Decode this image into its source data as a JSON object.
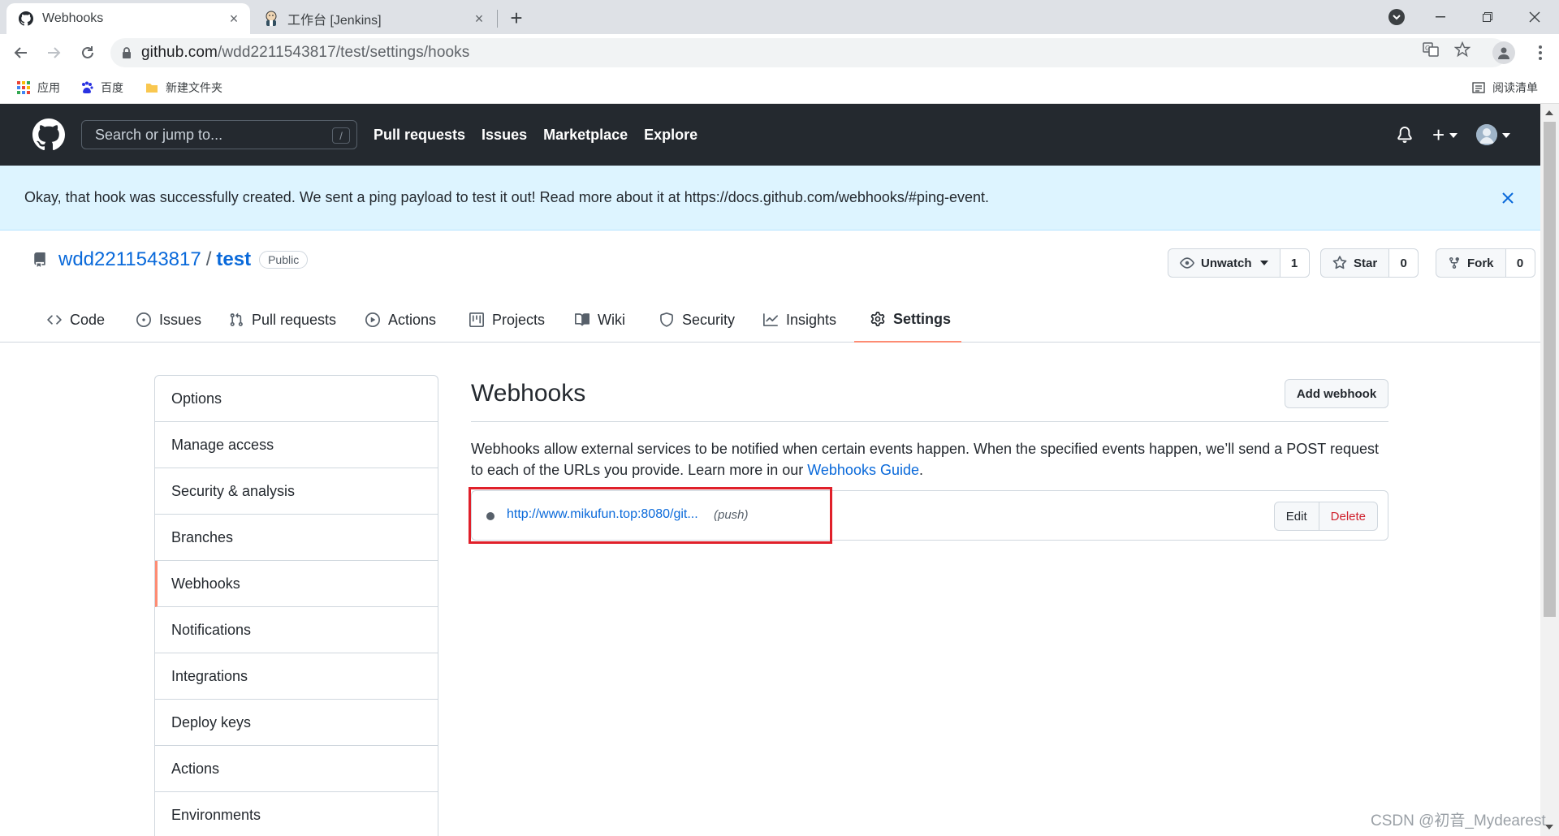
{
  "browser": {
    "tabs": [
      {
        "title": "Webhooks",
        "icon": "github-icon",
        "active": true
      },
      {
        "title": "工作台 [Jenkins]",
        "icon": "jenkins-icon",
        "active": false
      }
    ],
    "url_host": "github.com",
    "url_path": "/wdd2211543817/test/settings/hooks",
    "bookmarks": [
      {
        "label": "应用",
        "icon": "apps-grid-icon"
      },
      {
        "label": "百度",
        "icon": "baidu-paw-icon"
      },
      {
        "label": "新建文件夹",
        "icon": "folder-icon"
      }
    ],
    "reading_list": "阅读清单"
  },
  "header": {
    "search_placeholder": "Search or jump to...",
    "search_shortcut": "/",
    "nav": [
      "Pull requests",
      "Issues",
      "Marketplace",
      "Explore"
    ]
  },
  "flash": {
    "message": "Okay, that hook was successfully created. We sent a ping payload to test it out! Read more about it at https://docs.github.com/webhooks/#ping-event."
  },
  "repo": {
    "owner": "wdd2211543817",
    "separator": "/",
    "name": "test",
    "visibility": "Public",
    "watch_label": "Unwatch",
    "watch_count": "1",
    "star_label": "Star",
    "star_count": "0",
    "fork_label": "Fork",
    "fork_count": "0"
  },
  "repo_nav": [
    {
      "label": "Code",
      "icon": "code-icon"
    },
    {
      "label": "Issues",
      "icon": "issue-opened-icon"
    },
    {
      "label": "Pull requests",
      "icon": "git-pull-request-icon"
    },
    {
      "label": "Actions",
      "icon": "play-icon"
    },
    {
      "label": "Projects",
      "icon": "project-icon"
    },
    {
      "label": "Wiki",
      "icon": "book-icon"
    },
    {
      "label": "Security",
      "icon": "shield-icon"
    },
    {
      "label": "Insights",
      "icon": "graph-icon"
    },
    {
      "label": "Settings",
      "icon": "gear-icon",
      "selected": true
    }
  ],
  "sidebar": {
    "items": [
      {
        "label": "Options"
      },
      {
        "label": "Manage access"
      },
      {
        "label": "Security & analysis"
      },
      {
        "label": "Branches"
      },
      {
        "label": "Webhooks",
        "selected": true
      },
      {
        "label": "Notifications"
      },
      {
        "label": "Integrations"
      },
      {
        "label": "Deploy keys"
      },
      {
        "label": "Actions"
      },
      {
        "label": "Environments"
      }
    ]
  },
  "main": {
    "title": "Webhooks",
    "add_button": "Add webhook",
    "description": "Webhooks allow external services to be notified when certain events happen. When the specified events happen, we’ll send a POST request to each of the URLs you provide. Learn more in our ",
    "guide_link": "Webhooks Guide",
    "description_end": ".",
    "hook": {
      "url": "http://www.mikufun.top:8080/git...",
      "events": "(push)",
      "edit_label": "Edit",
      "delete_label": "Delete"
    }
  },
  "watermark": "CSDN @初音_Mydearest",
  "colors": {
    "header_bg": "#24292f",
    "flash_bg": "#ddf4ff",
    "link": "#0969da",
    "selected_accent": "#fd8c73",
    "danger": "#cf222e",
    "highlight_box": "#e0202a"
  }
}
